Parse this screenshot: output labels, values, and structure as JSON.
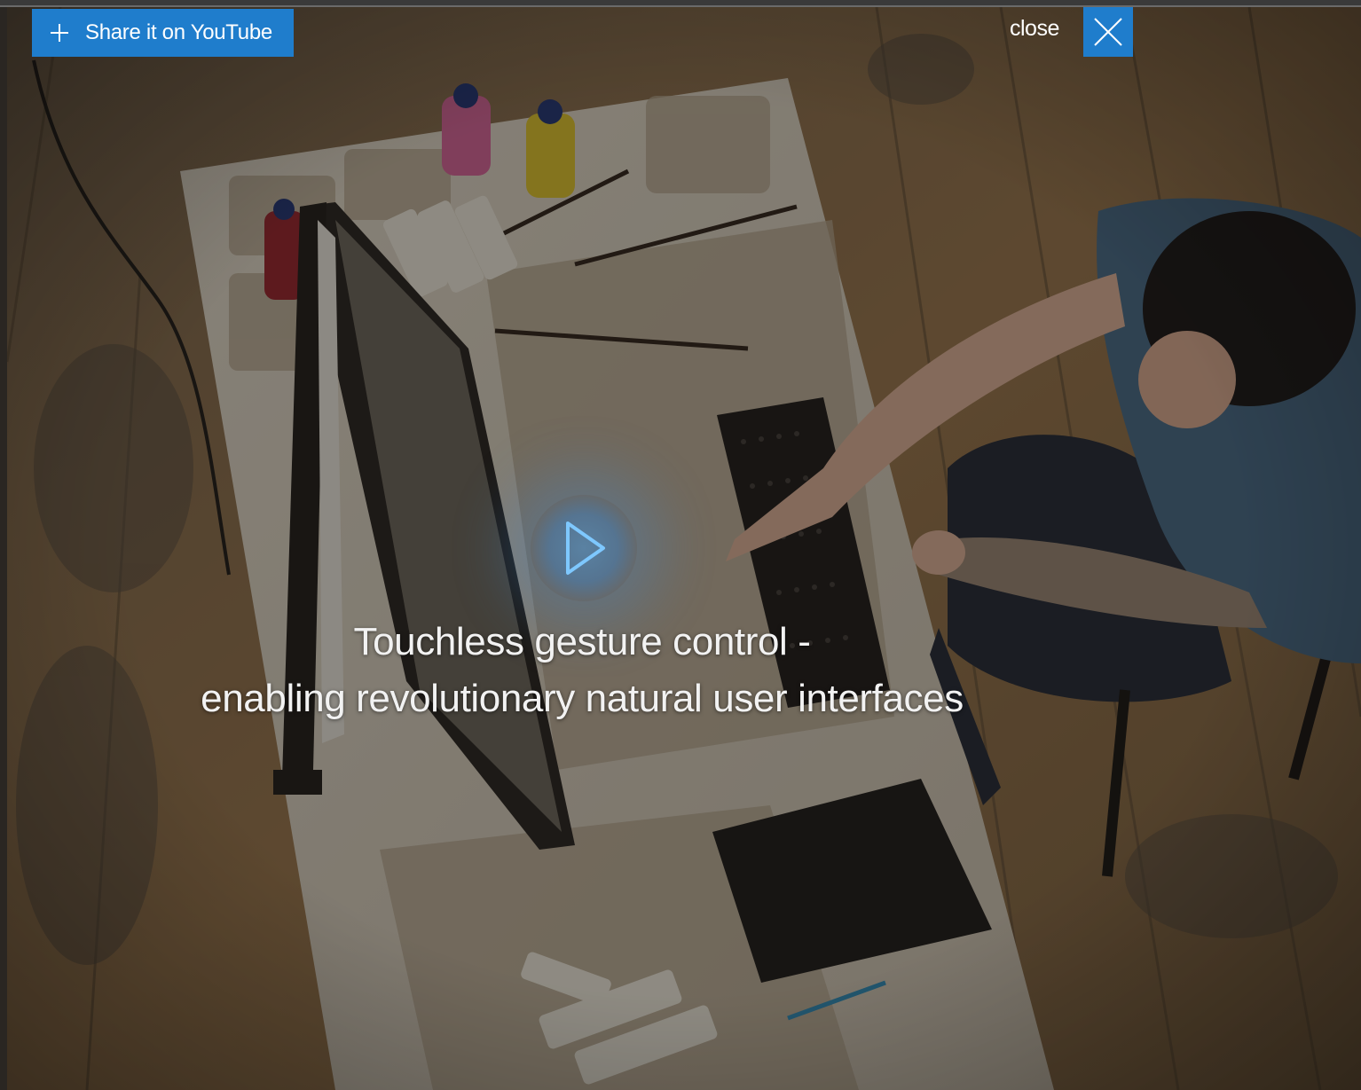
{
  "player": {
    "share_label": "Share it on YouTube",
    "close_label": "close",
    "caption_line_1": "Touchless gesture control -",
    "caption_line_2": "enabling revolutionary natural user interfaces"
  },
  "icons": {
    "share": "plus-icon",
    "close": "close-x-icon",
    "play": "play-icon"
  },
  "colors": {
    "accent": "#1f7dcc",
    "caption_text": "#f2f2f2"
  }
}
